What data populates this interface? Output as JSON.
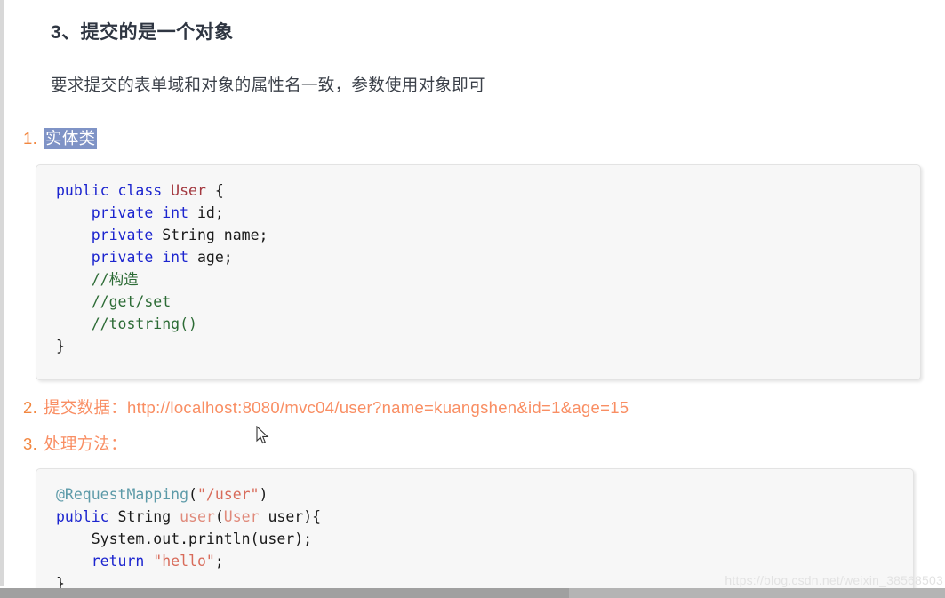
{
  "page": {
    "heading": "3、提交的是一个对象",
    "intro": "要求提交的表单域和对象的属性名一致，参数使用对象即可",
    "watermark": "https://blog.csdn.net/weixin_38568503"
  },
  "list": {
    "item1": {
      "marker": "1.",
      "label": "实体类",
      "highlighted": true,
      "highlight_color": "#7f93c6"
    },
    "item2": {
      "marker": "2.",
      "label": "提交数据：",
      "url": "http://localhost:8080/mvc04/user?name=kuangshen&id=1&age=15",
      "color": "#f98e63"
    },
    "item3": {
      "marker": "3.",
      "label": "处理方法：",
      "color": "#f98e63"
    }
  },
  "code_blocks": [
    {
      "id": "entity-class",
      "language": "java",
      "lines": [
        "public class User {",
        "    private int id;",
        "    private String name;",
        "    private int age;",
        "    //构造",
        "    //get/set",
        "    //tostring()",
        "}"
      ]
    },
    {
      "id": "controller-method",
      "language": "java",
      "lines": [
        "@RequestMapping(\"/user\")",
        "public String user(User user){",
        "    System.out.println(user);",
        "    return \"hello\";",
        "}"
      ]
    }
  ],
  "decorations": {
    "heart_icon": "♥",
    "heart_color": "#8b907c",
    "cursor": "arrow-pointer"
  },
  "colors": {
    "heading": "#2f3642",
    "body_text": "#3b4049",
    "marker_orange": "#f2863f",
    "accent_orange": "#f98e63",
    "code_bg": "#f7f7f7",
    "keyword": "#1c25cf",
    "class_name": "#a3383f",
    "comment": "#2c6b35",
    "annotation": "#5c9aa8",
    "string": "#d86b5a"
  }
}
